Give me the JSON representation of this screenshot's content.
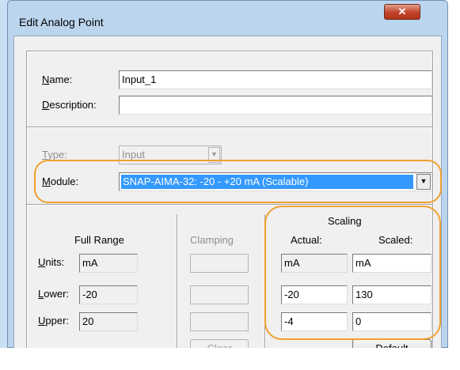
{
  "window": {
    "title": "Edit Analog Point",
    "close_glyph": "✕"
  },
  "identity": {
    "name_label": "ame:",
    "name_label_u": "N",
    "name_value": "Input_1",
    "description_label": "escription:",
    "description_label_u": "D",
    "description_value": ""
  },
  "module_section": {
    "type_label": "ype:",
    "type_label_u": "T",
    "type_value": "Input",
    "module_label": "odule:",
    "module_label_u": "M",
    "module_value": "SNAP-AIMA-32: -20 - +20 mA (Scalable)",
    "combo_arrow": "▼"
  },
  "ranges": {
    "full_range_header": "Full Range",
    "clamping_header": "Clamping",
    "scaling_header": "Scaling",
    "actual_header": "Actual:",
    "scaled_header": "Scaled:",
    "units_label_u": "U",
    "units_label": "nits:",
    "lower_label_u": "L",
    "lower_label": "ower:",
    "upper_label_u": "U",
    "upper_label": "pper:",
    "full_units": "mA",
    "full_lower": "-20",
    "full_upper": "20",
    "clamp_units": "",
    "clamp_lower": "",
    "clamp_upper": "",
    "actual_units": "mA",
    "actual_lower": "-20",
    "actual_upper": "-4",
    "scaled_units": "mA",
    "scaled_lower": "130",
    "scaled_upper": "0"
  },
  "buttons": {
    "clear_label": "Clea",
    "clear_label_u": "r",
    "default_label": "efault",
    "default_label_u": "D"
  },
  "colors": {
    "highlight": "#f0a030",
    "selection": "#3399ff"
  }
}
